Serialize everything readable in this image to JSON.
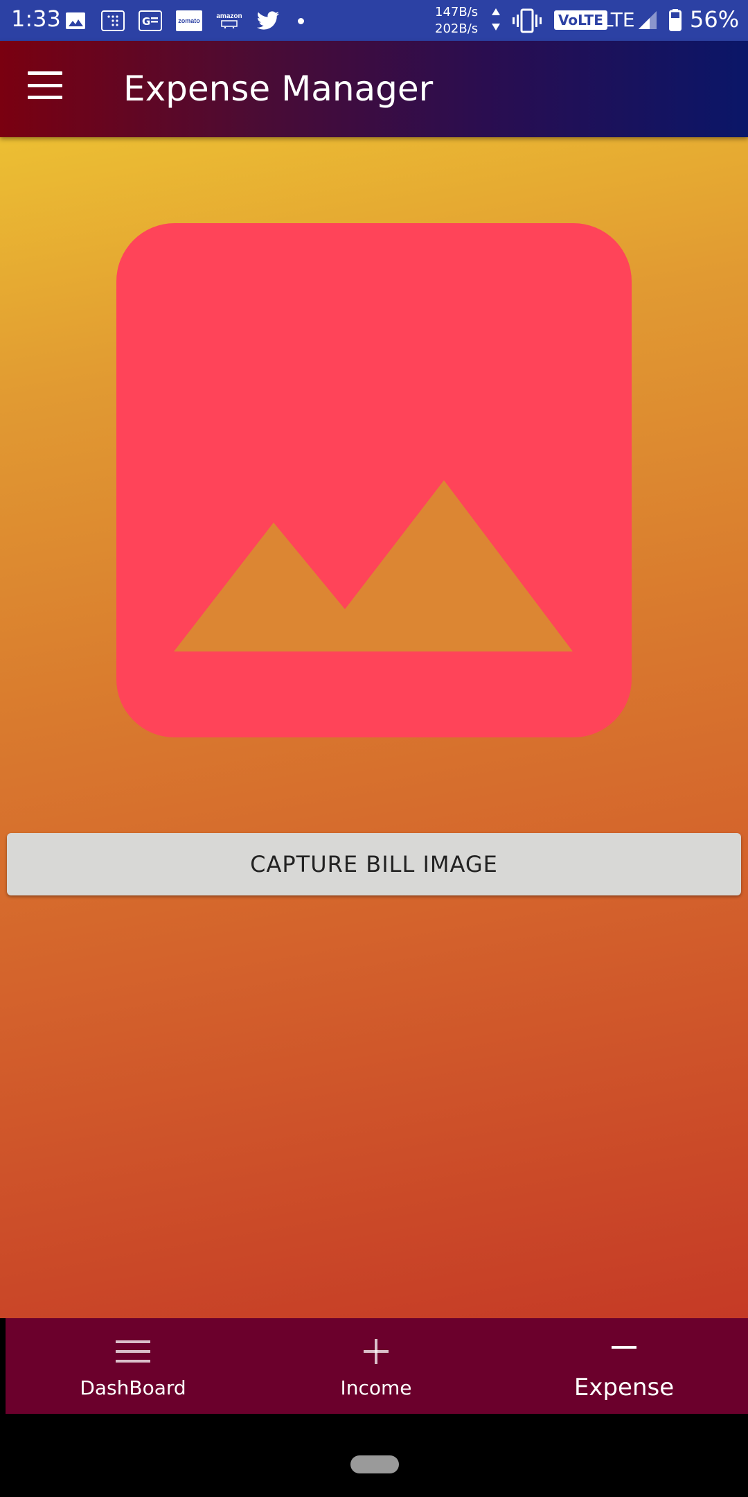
{
  "status_bar": {
    "time": "1:33",
    "net_up": "147B/s",
    "net_down": "202B/s",
    "volte": "VoLTE",
    "lte": "LTE",
    "battery_pct": "56%",
    "notification_icons": [
      "gallery-icon",
      "dialpad-icon",
      "news-icon",
      "zomato-icon",
      "amazon-icon",
      "twitter-icon"
    ],
    "zomato_label": "zomato",
    "amazon_label": "amazon"
  },
  "app_bar": {
    "title": "Expense Manager"
  },
  "main": {
    "capture_button_label": "CAPTURE BILL IMAGE",
    "placeholder_color": "#ff4459"
  },
  "bottom_nav": {
    "items": [
      {
        "label": "DashBoard",
        "icon": "menu-icon",
        "active": false
      },
      {
        "label": "Income",
        "icon": "plus-icon",
        "active": false
      },
      {
        "label": "Expense",
        "icon": "minus-icon",
        "active": true
      }
    ]
  },
  "colors": {
    "status_bar": "#2c41a4",
    "bottom_nav": "#6b002c",
    "button_bg": "#d8d8d6"
  }
}
